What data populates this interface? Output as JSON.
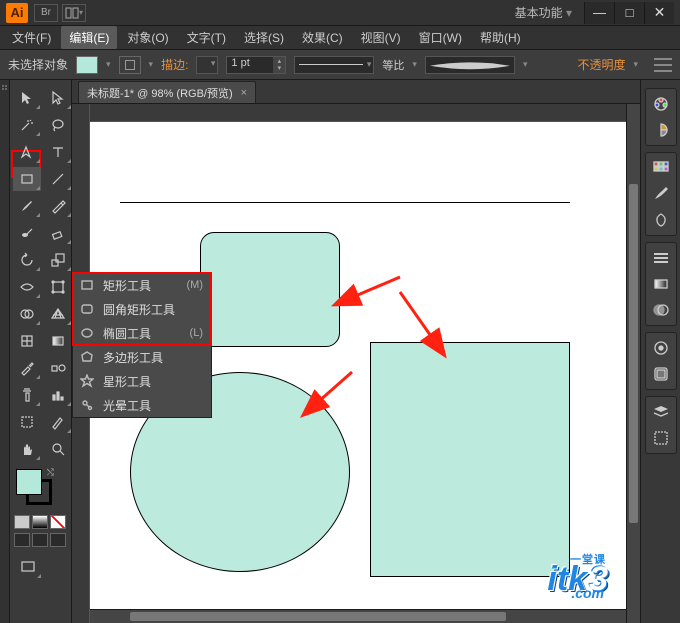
{
  "titlebar": {
    "logo": "Ai",
    "br_label": "Br",
    "workspace_label": "基本功能"
  },
  "window_buttons": {
    "min": "—",
    "max": "□",
    "close": "✕"
  },
  "menus": {
    "file": "文件(F)",
    "edit": "编辑(E)",
    "object": "对象(O)",
    "type": "文字(T)",
    "select": "选择(S)",
    "effect": "效果(C)",
    "view": "视图(V)",
    "window": "窗口(W)",
    "help": "帮助(H)"
  },
  "controlbar": {
    "no_selection": "未选择对象",
    "stroke_label": "描边:",
    "stroke_weight": "1 pt",
    "uniform": "等比",
    "opacity_label": "不透明度"
  },
  "document": {
    "tab_label": "未标题-1* @ 98% (RGB/预览)",
    "tab_close": "×"
  },
  "flyout": {
    "rectangle": {
      "label": "矩形工具",
      "shortcut": "(M)"
    },
    "rounded": {
      "label": "圆角矩形工具",
      "shortcut": ""
    },
    "ellipse": {
      "label": "椭圆工具",
      "shortcut": "(L)"
    },
    "polygon": {
      "label": "多边形工具",
      "shortcut": ""
    },
    "star": {
      "label": "星形工具",
      "shortcut": ""
    },
    "flare": {
      "label": "光晕工具",
      "shortcut": ""
    }
  },
  "colors": {
    "fill": "#bceadd",
    "accent": "#e88f3b",
    "highlight": "#ff0000",
    "brand": "#1f86e6"
  },
  "watermark": {
    "text1": "itk",
    "text2": "3",
    "side": "一堂课",
    "com": ".com"
  }
}
